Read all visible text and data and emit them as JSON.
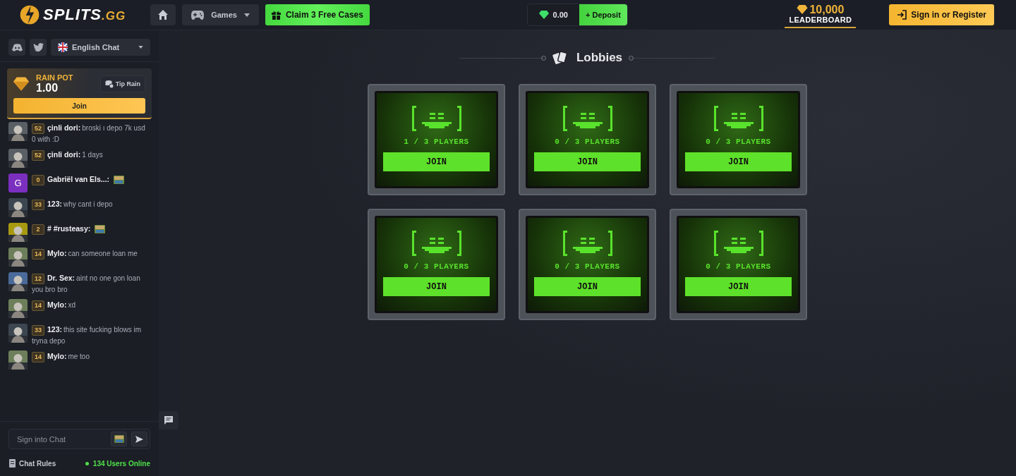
{
  "header": {
    "logo": {
      "main": "SPLITS",
      "suffix": ".GG"
    },
    "games_label": "Games",
    "claim_label": "Claim 3 Free Cases",
    "balance": "0.00",
    "deposit_label": "+ Deposit",
    "leaderboard": {
      "amount": "10,000",
      "label": "LEADERBOARD",
      "selected": true
    },
    "signin_label": "Sign in or Register"
  },
  "sidebar": {
    "chat_language": "English Chat",
    "rain": {
      "title": "RAIN POT",
      "amount": "1.00",
      "tip_label": "Tip Rain",
      "join_label": "Join"
    },
    "messages": [
      {
        "level": "52",
        "name": "çinli dori:",
        "text": "broski ı depo 7k usd 0 with :D",
        "emote": false
      },
      {
        "level": "52",
        "name": "çinli dori:",
        "text": "1 days",
        "emote": false
      },
      {
        "avatar": {
          "kind": "letter",
          "letter": "G",
          "color": "#7b2fbe"
        },
        "level": "0",
        "name": "Gabriël van Els...:",
        "emote": true
      },
      {
        "level": "33",
        "name": "123:",
        "text": "why cant i depo",
        "emote": false
      },
      {
        "level": "2",
        "name": "# #rusteasy:",
        "emote": true
      },
      {
        "level": "14",
        "name": "Mylo:",
        "text": "can someone loan me",
        "emote": false
      },
      {
        "level": "12",
        "name": "Dr. Sex:",
        "text": "aint no one gon loan you bro bro",
        "emote": false
      },
      {
        "level": "14",
        "name": "Mylo:",
        "text": "xd",
        "emote": false
      },
      {
        "level": "33",
        "name": "123:",
        "text": "this site fucking blows im tryna depo",
        "emote": false
      },
      {
        "level": "14",
        "name": "Mylo:",
        "text": "me too",
        "emote": false
      }
    ],
    "chat_input": {
      "placeholder": "Sign into Chat"
    },
    "rules_label": "Chat Rules",
    "online": "134 Users Online"
  },
  "main": {
    "title": "Lobbies",
    "lobbies": [
      {
        "players": "1 / 3 PLAYERS",
        "join_label": "JOIN"
      },
      {
        "players": "0 / 3 PLAYERS",
        "join_label": "JOIN"
      },
      {
        "players": "0 / 3 PLAYERS",
        "join_label": "JOIN"
      },
      {
        "players": "0 / 3 PLAYERS",
        "join_label": "JOIN"
      },
      {
        "players": "0 / 3 PLAYERS",
        "join_label": "JOIN"
      },
      {
        "players": "0 / 3 PLAYERS",
        "join_label": "JOIN"
      }
    ]
  }
}
